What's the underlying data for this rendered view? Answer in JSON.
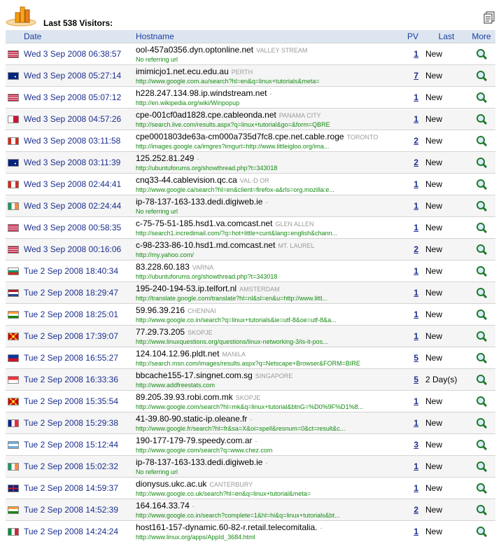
{
  "title": "Last 538 Visitors:",
  "columns": {
    "date": "Date",
    "hostname": "Hostname",
    "pv": "PV",
    "last": "Last",
    "more": "More"
  },
  "rows": [
    {
      "flag": "us",
      "date": "Wed 3 Sep 2008 06:38:57",
      "host": "ool-457a0356.dyn.optonline.net",
      "location": "VALLEY STREAM",
      "referrer": "No referring url",
      "pv": "1",
      "last": "New"
    },
    {
      "flag": "au",
      "date": "Wed 3 Sep 2008 05:27:14",
      "host": "imimicjo1.net.ecu.edu.au",
      "location": "PERTH",
      "referrer": "http://www.google.com.au/search?hl=en&q=linux+tutorials&meta=",
      "pv": "7",
      "last": "New"
    },
    {
      "flag": "us",
      "date": "Wed 3 Sep 2008 05:07:12",
      "host": "h228.247.134.98.ip.windstream.net",
      "location": "-",
      "referrer": "http://en.wikipedia.org/wiki/Winpopup",
      "pv": "1",
      "last": "New"
    },
    {
      "flag": "pa",
      "date": "Wed 3 Sep 2008 04:57:26",
      "host": "cpe-001cf0ad1828.cpe.cableonda.net",
      "location": "PANAMA CITY",
      "referrer": "http://search.live.com/results.aspx?q=linux+tutorial&go=&form=QBRE",
      "pv": "1",
      "last": "New"
    },
    {
      "flag": "ca",
      "date": "Wed 3 Sep 2008 03:11:58",
      "host": "cpe0001803de63a-cm000a735d7fc8.cpe.net.cable.roge",
      "location": "TORONTO",
      "referrer": "http://images.google.ca/imgres?imgurl=http://www.littleigloo.org/ima...",
      "pv": "2",
      "last": "New"
    },
    {
      "flag": "au",
      "date": "Wed 3 Sep 2008 03:11:39",
      "host": "125.252.81.249",
      "location": "-",
      "referrer": "http://ubuntuforums.org/showthread.php?t=343018",
      "pv": "2",
      "last": "New"
    },
    {
      "flag": "ca",
      "date": "Wed 3 Sep 2008 02:44:41",
      "host": "cnq33-44.cablevision.qc.ca",
      "location": "VAL-D OR",
      "referrer": "http://www.google.ca/search?hl=en&client=firefox-a&rls=org.mozilla:e...",
      "pv": "1",
      "last": "New"
    },
    {
      "flag": "ie",
      "date": "Wed 3 Sep 2008 02:24:44",
      "host": "ip-78-137-163-133.dedi.digiweb.ie",
      "location": "-",
      "referrer": "No referring url",
      "pv": "1",
      "last": "New"
    },
    {
      "flag": "us",
      "date": "Wed 3 Sep 2008 00:58:35",
      "host": "c-75-75-51-185.hsd1.va.comcast.net",
      "location": "GLEN ALLEN",
      "referrer": "http://search1.incredimail.com/?q=hot+little+cunt&lang=english&chann...",
      "pv": "1",
      "last": "New"
    },
    {
      "flag": "us",
      "date": "Wed 3 Sep 2008 00:16:06",
      "host": "c-98-233-86-10.hsd1.md.comcast.net",
      "location": "MT. LAUREL",
      "referrer": "http://my.yahoo.com/",
      "pv": "2",
      "last": "New"
    },
    {
      "flag": "bg",
      "date": "Tue 2 Sep 2008 18:40:34",
      "host": "83.228.60.183",
      "location": "VARNA",
      "referrer": "http://ubuntuforums.org/showthread.php?t=343018",
      "pv": "1",
      "last": "New"
    },
    {
      "flag": "nl",
      "date": "Tue 2 Sep 2008 18:29:47",
      "host": "195-240-194-53.ip.telfort.nl",
      "location": "AMSTERDAM",
      "referrer": "http://translate.google.com/translate?hl=nl&sl=en&u=http://www.littl...",
      "pv": "1",
      "last": "New"
    },
    {
      "flag": "in",
      "date": "Tue 2 Sep 2008 18:25:01",
      "host": "59.96.39.216",
      "location": "CHENNAI",
      "referrer": "http://www.google.co.in/search?q=linux+tutorials&ie=utf-8&oe=utf-8&a...",
      "pv": "1",
      "last": "New"
    },
    {
      "flag": "mk",
      "date": "Tue 2 Sep 2008 17:39:07",
      "host": "77.29.73.205",
      "location": "SKOPJE",
      "referrer": "http://www.linuxquestions.org/questions/linux-networking-3/is-it-pos...",
      "pv": "1",
      "last": "New"
    },
    {
      "flag": "ph",
      "date": "Tue 2 Sep 2008 16:55:27",
      "host": "124.104.12.96.pldt.net",
      "location": "MANILA",
      "referrer": "http://search.msn.com/images/results.aspx?q=Netscape+Browser&FORM=BIRE",
      "pv": "5",
      "last": "New"
    },
    {
      "flag": "sg",
      "date": "Tue 2 Sep 2008 16:33:36",
      "host": "bbcache155-17.singnet.com.sg",
      "location": "SINGAPORE",
      "referrer": "http://www.addfreestats.com",
      "pv": "5",
      "last": "2 Day(s)"
    },
    {
      "flag": "mk",
      "date": "Tue 2 Sep 2008 15:35:54",
      "host": "89.205.39.93.robi.com.mk",
      "location": "SKOPJE",
      "referrer": "http://www.google.com/search?hl=mk&q=linux+tutorial&btnG=%D0%9F%D1%8...",
      "pv": "1",
      "last": "New"
    },
    {
      "flag": "fr",
      "date": "Tue 2 Sep 2008 15:29:38",
      "host": "41-39.80-90.static-ip.oleane.fr",
      "location": "-",
      "referrer": "http://www.google.fr/search?hl=fr&sa=X&oi=spell&resnum=0&ct=result&c...",
      "pv": "1",
      "last": "New"
    },
    {
      "flag": "ar",
      "date": "Tue 2 Sep 2008 15:12:44",
      "host": "190-177-179-79.speedy.com.ar",
      "location": "-",
      "referrer": "http://www.google.com/search?q=www.chez.com",
      "pv": "3",
      "last": "New"
    },
    {
      "flag": "ie",
      "date": "Tue 2 Sep 2008 15:02:32",
      "host": "ip-78-137-163-133.dedi.digiweb.ie",
      "location": "-",
      "referrer": "No referring url",
      "pv": "1",
      "last": "New"
    },
    {
      "flag": "gb",
      "date": "Tue 2 Sep 2008 14:59:37",
      "host": "dionysus.ukc.ac.uk",
      "location": "CANTERBURY",
      "referrer": "http://www.google.co.uk/search?hl=en&q=linux+tutorial&meta=",
      "pv": "1",
      "last": "New"
    },
    {
      "flag": "in",
      "date": "Tue 2 Sep 2008 14:52:39",
      "host": "164.164.33.74",
      "location": "-",
      "referrer": "http://www.google.co.in/search?complete=1&hl=hi&q=linux+tutorials&bt...",
      "pv": "2",
      "last": "New"
    },
    {
      "flag": "it",
      "date": "Tue 2 Sep 2008 14:24:24",
      "host": "host161-157-dynamic.60-82-r.retail.telecomitalia.",
      "location": "-",
      "referrer": "http://www.linux.org/apps/AppId_3684.html",
      "pv": "1",
      "last": "New"
    }
  ],
  "colors": {
    "date": "#1c2f8e",
    "header_bg": "#dde5f0",
    "referrer": "#138a13",
    "location": "#9a9a9a"
  },
  "icons": {
    "logo": "bar-chart-logo-icon",
    "export": "copy-page-icon",
    "more": "magnifier-details-icon"
  }
}
